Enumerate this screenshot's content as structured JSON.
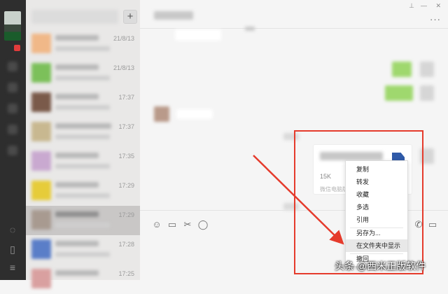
{
  "colors": {
    "rail": "#2e2e2e",
    "list": "#e9e8e7",
    "chat": "#f5f5f5",
    "accent_red": "#e53b2c",
    "file_icon": "#2f5aa8"
  },
  "header": {
    "plus_label": "+",
    "pin_icon": "pin-icon",
    "close_label": "✕",
    "more_label": "···"
  },
  "conversations": [
    {
      "time": "21/8/13"
    },
    {
      "time": "21/8/13"
    },
    {
      "time": "17:37"
    },
    {
      "time": "17:37"
    },
    {
      "time": "17:35"
    },
    {
      "time": "17:29"
    },
    {
      "time": "17:29"
    },
    {
      "time": "17:28"
    },
    {
      "time": "17:25"
    }
  ],
  "file_message": {
    "size": "15K",
    "source": "微信电脑版"
  },
  "context_menu": {
    "items": [
      {
        "label": "复制"
      },
      {
        "label": "转发"
      },
      {
        "label": "收藏"
      },
      {
        "label": "多选"
      },
      {
        "label": "引用"
      },
      {
        "label": "另存为..."
      },
      {
        "label": "在文件夹中显示"
      },
      {
        "label": "撤回"
      }
    ],
    "highlighted": "在文件夹中显示"
  },
  "toolbar_icons": [
    "emoji-icon",
    "folder-icon",
    "scissors-icon",
    "chat-bubble-icon",
    "phone-icon",
    "video-icon"
  ],
  "watermark": "头条 @西米正版软件"
}
